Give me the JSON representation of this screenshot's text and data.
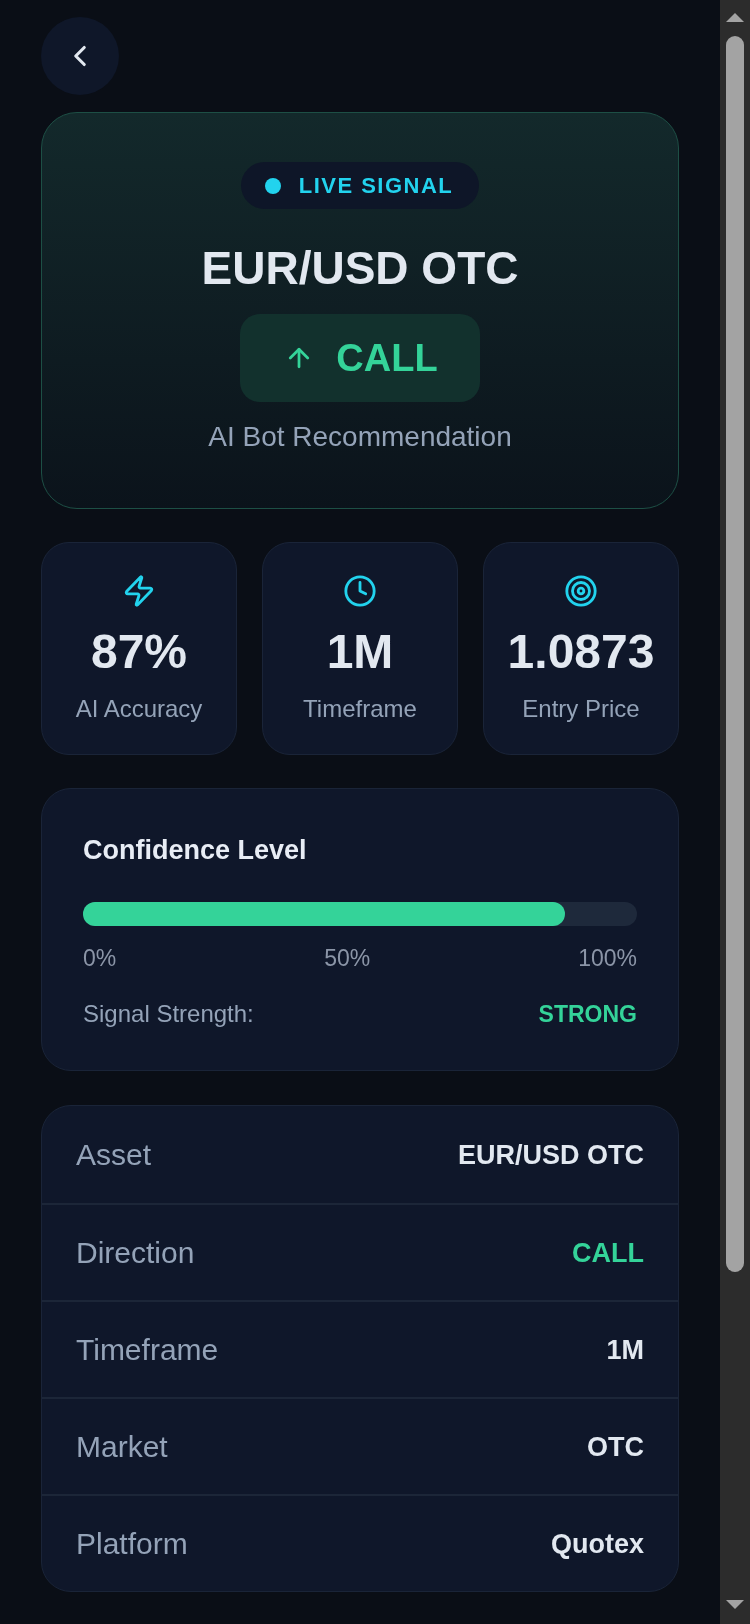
{
  "signal_card": {
    "badge": "LIVE SIGNAL",
    "asset": "EUR/USD OTC",
    "direction": {
      "kind": "call",
      "label": "CALL"
    },
    "caption": "AI Bot Recommendation"
  },
  "stats": [
    {
      "kind": "accuracy",
      "value": "87%",
      "label": "AI Accuracy"
    },
    {
      "kind": "timeframe",
      "value": "1M",
      "label": "Timeframe"
    },
    {
      "kind": "entry",
      "value": "1.0873",
      "label": "Entry Price"
    }
  ],
  "confidence": {
    "title": "Confidence Level",
    "level": 0.87,
    "scale": [
      "0%",
      "50%",
      "100%"
    ],
    "strength_label": "Signal Strength:",
    "strength": "STRONG"
  },
  "details": [
    {
      "kind": "text",
      "label": "Asset",
      "value": "EUR/USD OTC"
    },
    {
      "kind": "call",
      "label": "Direction",
      "value": "CALL"
    },
    {
      "kind": "text",
      "label": "Timeframe",
      "value": "1M"
    },
    {
      "kind": "text",
      "label": "Market",
      "value": "OTC"
    },
    {
      "kind": "text",
      "label": "Platform",
      "value": "Quotex"
    }
  ]
}
